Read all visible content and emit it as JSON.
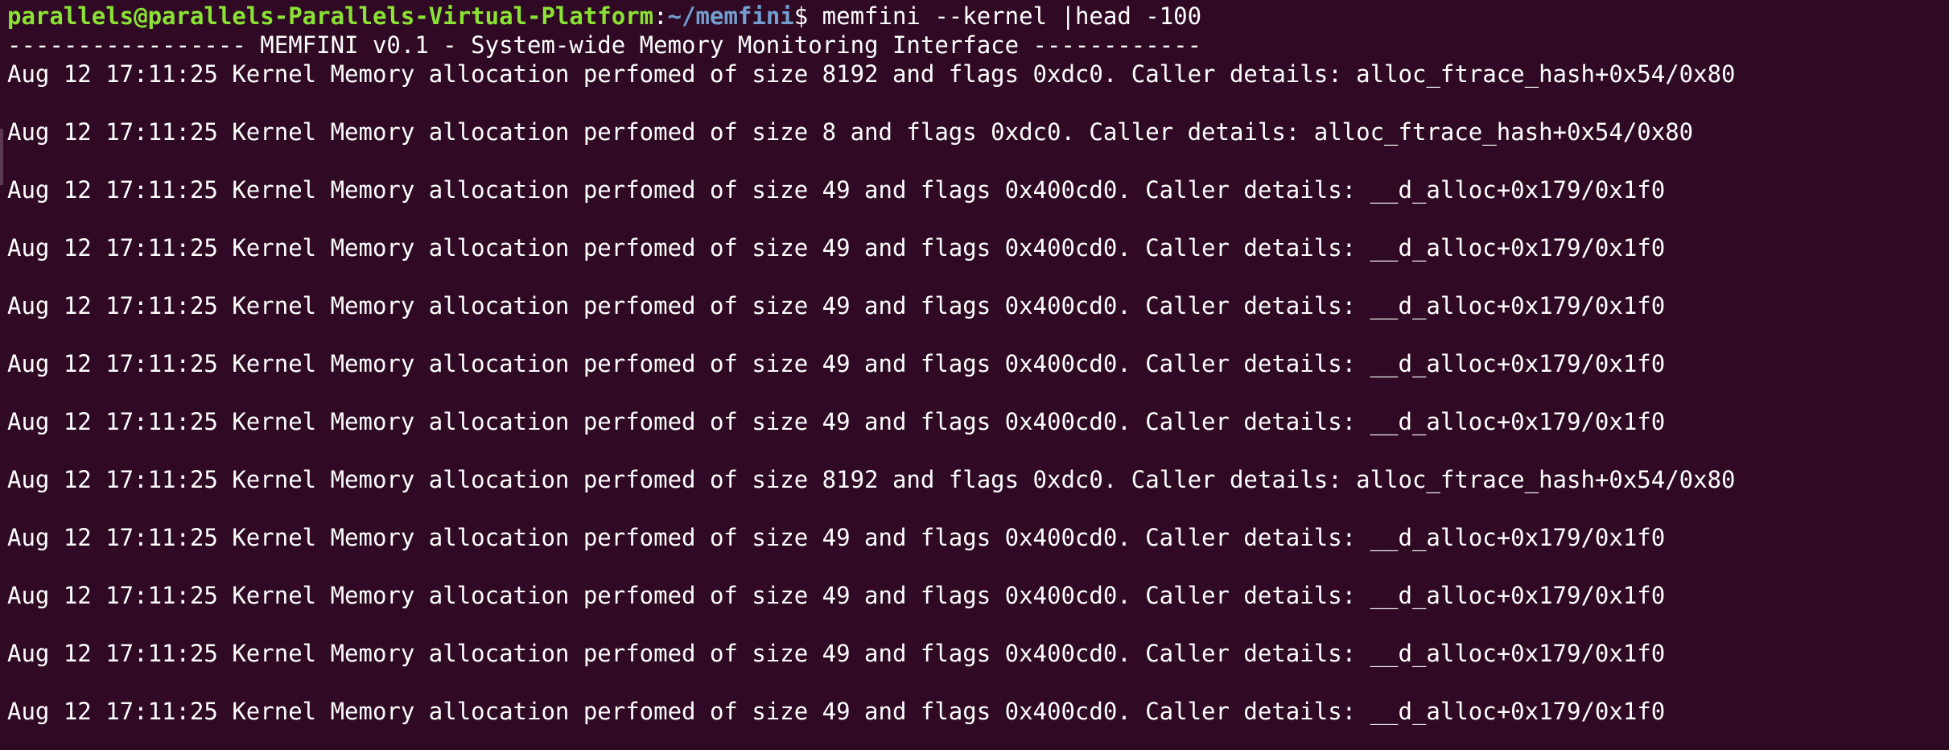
{
  "terminal": {
    "prompt": {
      "user_host": "parallels@parallels-Parallels-Virtual-Platform",
      "colon": ":",
      "path": "~/memfini",
      "symbol": "$ ",
      "command": "memfini --kernel |head -100"
    },
    "header_line": "----------------- MEMFINI v0.1 - System-wide Memory Monitoring Interface ------------",
    "log_lines": [
      "Aug 12 17:11:25 Kernel Memory allocation perfomed of size 8192 and flags 0xdc0. Caller details: alloc_ftrace_hash+0x54/0x80",
      "Aug 12 17:11:25 Kernel Memory allocation perfomed of size 8 and flags 0xdc0. Caller details: alloc_ftrace_hash+0x54/0x80",
      "Aug 12 17:11:25 Kernel Memory allocation perfomed of size 49 and flags 0x400cd0. Caller details: __d_alloc+0x179/0x1f0",
      "Aug 12 17:11:25 Kernel Memory allocation perfomed of size 49 and flags 0x400cd0. Caller details: __d_alloc+0x179/0x1f0",
      "Aug 12 17:11:25 Kernel Memory allocation perfomed of size 49 and flags 0x400cd0. Caller details: __d_alloc+0x179/0x1f0",
      "Aug 12 17:11:25 Kernel Memory allocation perfomed of size 49 and flags 0x400cd0. Caller details: __d_alloc+0x179/0x1f0",
      "Aug 12 17:11:25 Kernel Memory allocation perfomed of size 49 and flags 0x400cd0. Caller details: __d_alloc+0x179/0x1f0",
      "Aug 12 17:11:25 Kernel Memory allocation perfomed of size 8192 and flags 0xdc0. Caller details: alloc_ftrace_hash+0x54/0x80",
      "Aug 12 17:11:25 Kernel Memory allocation perfomed of size 49 and flags 0x400cd0. Caller details: __d_alloc+0x179/0x1f0",
      "Aug 12 17:11:25 Kernel Memory allocation perfomed of size 49 and flags 0x400cd0. Caller details: __d_alloc+0x179/0x1f0",
      "Aug 12 17:11:25 Kernel Memory allocation perfomed of size 49 and flags 0x400cd0. Caller details: __d_alloc+0x179/0x1f0",
      "Aug 12 17:11:25 Kernel Memory allocation perfomed of size 49 and flags 0x400cd0. Caller details: __d_alloc+0x179/0x1f0"
    ],
    "colors": {
      "background": "#300a24",
      "text": "#ffffff",
      "prompt_user": "#8ae234",
      "prompt_path": "#729fcf"
    }
  }
}
